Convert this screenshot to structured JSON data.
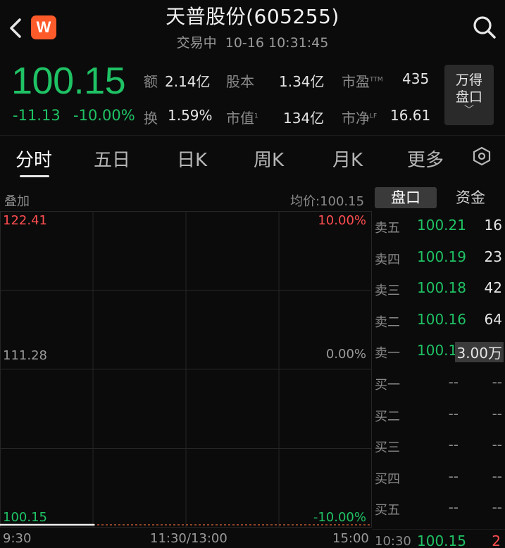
{
  "header": {
    "badge": "W",
    "title": "天普股份(605255)",
    "status": "交易中",
    "datetime": "10-16 10:31:45"
  },
  "quote": {
    "price": "100.15",
    "change": "-11.13",
    "change_pct": "-10.00%",
    "stats": {
      "amount_label": "额",
      "amount": "2.14亿",
      "turnover_label": "换",
      "turnover": "1.59%",
      "shares_label": "股本",
      "shares": "1.34亿",
      "mktcap_label": "市值",
      "mktcap_sup": "1",
      "mktcap": "134亿",
      "pe_label": "市盈",
      "pe_sup": "TTM",
      "pe": "435",
      "pb_label": "市净",
      "pb_sup": "LF",
      "pb": "16.61"
    },
    "wind_button": {
      "line1": "万得",
      "line2": "盘口"
    }
  },
  "tabs": [
    "分时",
    "五日",
    "日K",
    "周K",
    "月K",
    "更多"
  ],
  "chart": {
    "overlay_label": "叠加",
    "avg_label": "均价:100.15",
    "y_left": [
      "122.41",
      "111.28",
      "100.15"
    ],
    "y_right": [
      "10.00%",
      "0.00%",
      "-10.00%"
    ],
    "x_labels": [
      "9:30",
      "11:30/13:00",
      "15:00"
    ],
    "colors": {
      "up": "#ff4d4f",
      "down": "#1fc264",
      "neutral": "#9a9a9a"
    }
  },
  "chart_data": {
    "type": "line",
    "title": "",
    "x": [
      "9:30",
      "10:31"
    ],
    "series": [
      {
        "values": [
          100.15,
          100.15
        ]
      }
    ],
    "ylim": [
      100.15,
      122.41
    ],
    "xlabel": "",
    "ylabel": ""
  },
  "orderbook": {
    "tabs": [
      "盘口",
      "资金"
    ],
    "sell": [
      {
        "label": "卖五",
        "price": "100.21",
        "vol": "16"
      },
      {
        "label": "卖四",
        "price": "100.19",
        "vol": "23"
      },
      {
        "label": "卖三",
        "price": "100.18",
        "vol": "42"
      },
      {
        "label": "卖二",
        "price": "100.16",
        "vol": "64"
      },
      {
        "label": "卖一",
        "price": "100.15",
        "vol": "3.00万"
      }
    ],
    "buy": [
      {
        "label": "买一",
        "price": "--",
        "vol": "--"
      },
      {
        "label": "买二",
        "price": "--",
        "vol": "--"
      },
      {
        "label": "买三",
        "price": "--",
        "vol": "--"
      },
      {
        "label": "买四",
        "price": "--",
        "vol": "--"
      },
      {
        "label": "买五",
        "price": "--",
        "vol": "--"
      }
    ],
    "tick": {
      "time": "10:30",
      "price": "100.15",
      "vol": "2"
    }
  }
}
